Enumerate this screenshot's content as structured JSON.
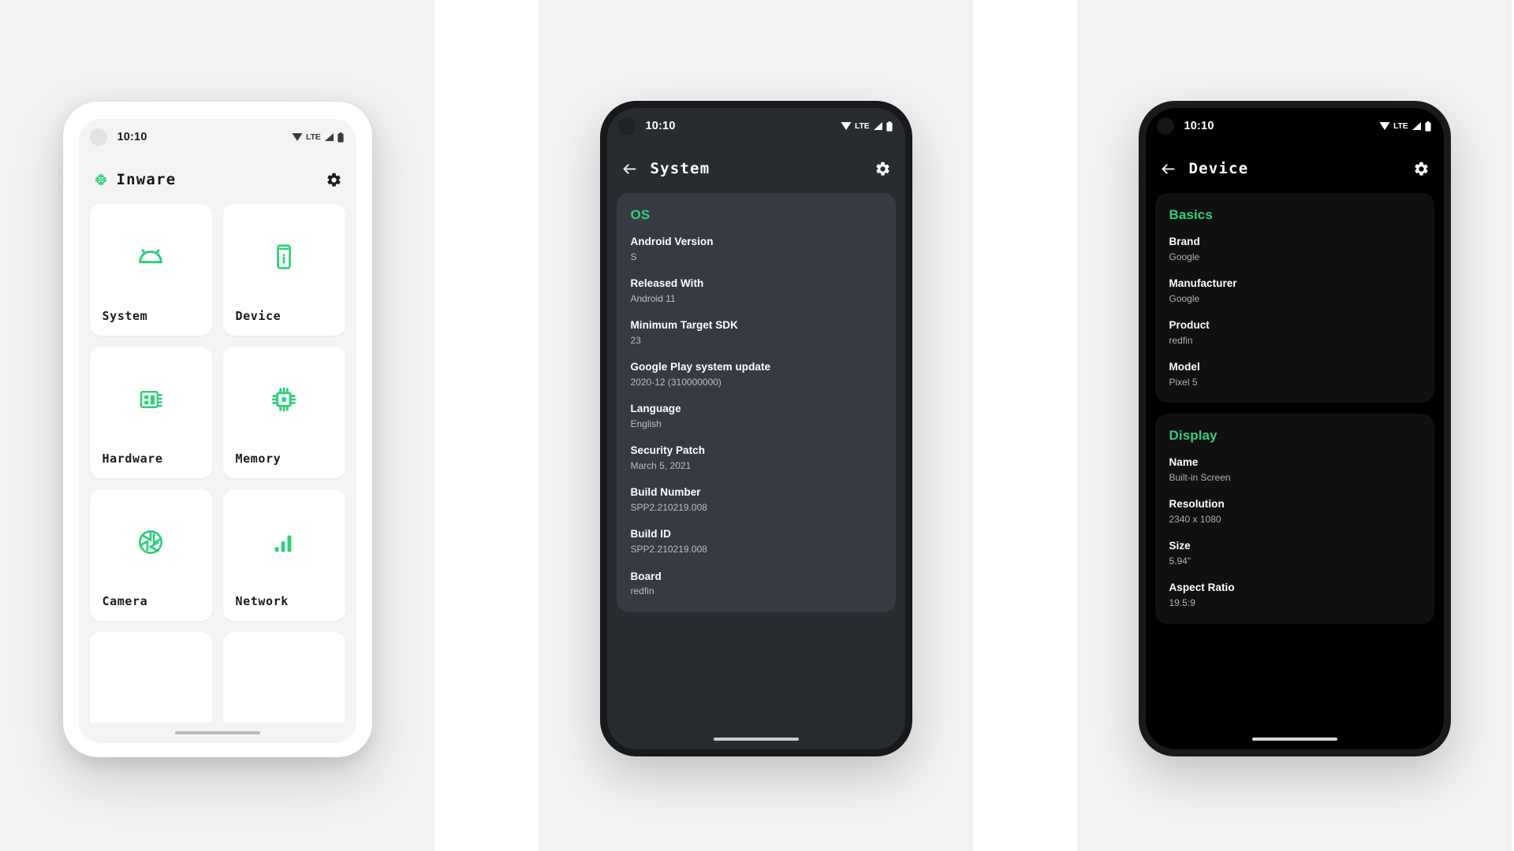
{
  "accent_green": "#2fd07a",
  "phone1": {
    "theme": "light",
    "status": {
      "clock": "10:10",
      "lte_label": "LTE"
    },
    "toolbar": {
      "brand_icon": "chip-icon",
      "title": "Inware",
      "settings_icon": "gear-icon"
    },
    "tiles": [
      {
        "icon": "android-icon",
        "label": "System"
      },
      {
        "icon": "device-info-icon",
        "label": "Device"
      },
      {
        "icon": "memory-chip-icon",
        "label": "Hardware"
      },
      {
        "icon": "cpu-icon",
        "label": "Memory"
      },
      {
        "icon": "camera-aperture-icon",
        "label": "Camera"
      },
      {
        "icon": "signal-bars-icon",
        "label": "Network"
      }
    ]
  },
  "phone2": {
    "theme": "dark",
    "status": {
      "clock": "10:10",
      "lte_label": "LTE"
    },
    "toolbar": {
      "back_icon": "arrow-left-icon",
      "title": "System",
      "settings_icon": "gear-icon"
    },
    "cards": [
      {
        "section": "OS",
        "rows": [
          {
            "label": "Android Version",
            "value": "S"
          },
          {
            "label": "Released With",
            "value": "Android 11"
          },
          {
            "label": "Minimum Target SDK",
            "value": "23"
          },
          {
            "label": "Google Play system update",
            "value": "2020-12 (310000000)"
          },
          {
            "label": "Language",
            "value": "English"
          },
          {
            "label": "Security Patch",
            "value": "March 5, 2021"
          },
          {
            "label": "Build Number",
            "value": "SPP2.210219.008"
          },
          {
            "label": "Build ID",
            "value": "SPP2.210219.008"
          },
          {
            "label": "Board",
            "value": "redfin"
          }
        ]
      }
    ]
  },
  "phone3": {
    "theme": "black",
    "status": {
      "clock": "10:10",
      "lte_label": "LTE"
    },
    "toolbar": {
      "back_icon": "arrow-left-icon",
      "title": "Device",
      "settings_icon": "gear-icon"
    },
    "cards": [
      {
        "section": "Basics",
        "rows": [
          {
            "label": "Brand",
            "value": "Google"
          },
          {
            "label": "Manufacturer",
            "value": "Google"
          },
          {
            "label": "Product",
            "value": "redfin"
          },
          {
            "label": "Model",
            "value": "Pixel 5"
          }
        ]
      },
      {
        "section": "Display",
        "rows": [
          {
            "label": "Name",
            "value": "Built-in Screen"
          },
          {
            "label": "Resolution",
            "value": "2340 x 1080"
          },
          {
            "label": "Size",
            "value": "5.94\""
          },
          {
            "label": "Aspect Ratio",
            "value": "19.5:9"
          }
        ]
      }
    ]
  }
}
